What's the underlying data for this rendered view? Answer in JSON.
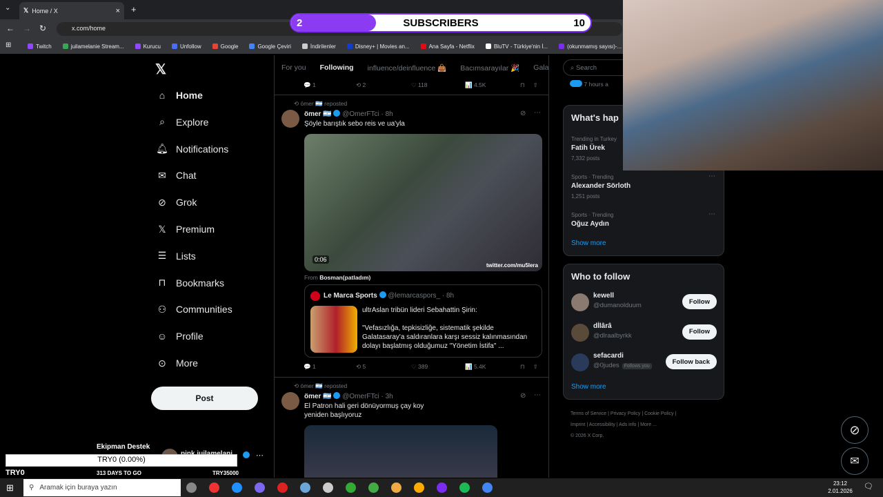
{
  "browser": {
    "tab_title": "Home / X",
    "url": "x.com/home",
    "bookmarks": [
      "Twitch",
      "juilamelanie Stream...",
      "Kurucu",
      "Unfollow",
      "Google",
      "Google Çeviri",
      "İndirilenler",
      "Disney+ | Movies an...",
      "Ana Sayfa - Netflix",
      "BluTV - Türkiye'nin İ...",
      "(okunmamış sayısı)-..."
    ]
  },
  "overlay": {
    "subs_current": "2",
    "subs_label": "SUBSCRIBERS",
    "subs_goal": "10",
    "subs_fraction": 0.2
  },
  "nav": {
    "items": [
      {
        "label": "Home",
        "icon": "home-icon"
      },
      {
        "label": "Explore",
        "icon": "search-icon"
      },
      {
        "label": "Notifications",
        "icon": "bell-icon"
      },
      {
        "label": "Chat",
        "icon": "mail-icon"
      },
      {
        "label": "Grok",
        "icon": "grok-icon"
      },
      {
        "label": "Premium",
        "icon": "x-logo-icon"
      },
      {
        "label": "Lists",
        "icon": "list-icon"
      },
      {
        "label": "Bookmarks",
        "icon": "bookmark-icon"
      },
      {
        "label": "Communities",
        "icon": "people-icon"
      },
      {
        "label": "Profile",
        "icon": "person-icon"
      },
      {
        "label": "More",
        "icon": "more-circle-icon"
      }
    ],
    "post_label": "Post"
  },
  "feed": {
    "tabs": [
      "For you",
      "Following",
      "influence/deinfluence 👜",
      "Bacımsarayılar 🎉",
      "Gala"
    ],
    "top_actions": {
      "replies": "1",
      "reposts": "2",
      "likes": "118",
      "views": "4.5K"
    },
    "post1": {
      "reposted_by": "ömer 🇦🇷 reposted",
      "name": "ömer 🇦🇷",
      "handle": "@OmerFTci",
      "time": "· 8h",
      "text": "Şöyle barıştık sebo reis ve ua'yla",
      "video_time": "0:06",
      "watermark": "twitter.com/mu5lera",
      "from_prefix": "From",
      "from_name": "Bosman(patladım)",
      "quote": {
        "name": "Le Marca Sports",
        "handle": "@lemarcaspors_",
        "time": "· 8h",
        "line1": "ultrAslan tribün lideri Sebahattin Şirin:",
        "line2": "\"Vefasızlığa, tepkisizliğe, sistematik şekilde",
        "line3": "Galatasaray'a saldıranlara karşı sessiz kalınmasından",
        "line4": "dolayı başlatmış olduğumuz \"Yönetim İstifa\" ..."
      },
      "actions": {
        "replies": "1",
        "reposts": "5",
        "likes": "389",
        "views": "5.4K"
      }
    },
    "post2": {
      "reposted_by": "ömer 🇦🇷 reposted",
      "name": "ömer 🇦🇷",
      "handle": "@OmerFTci",
      "time": "· 3h",
      "line1": "El Patron hali geri dönüyormuş çay koy",
      "line2": "yeniden başlıyoruz"
    }
  },
  "right": {
    "search_placeholder": "Search",
    "time_ago": "7 hours a",
    "trending_title": "What's hap",
    "trends": [
      {
        "meta": "Trending in Turkey",
        "name": "Fatih Ürek",
        "count": "7,332 posts"
      },
      {
        "meta": "Sports · Trending",
        "name": "Alexander Sörloth",
        "count": "1,251 posts"
      },
      {
        "meta": "Sports · Trending",
        "name": "Oğuz Aydın",
        "count": ""
      }
    ],
    "show_more": "Show more",
    "who_title": "Who to follow",
    "follow": [
      {
        "name": "kewell",
        "handle": "@dumanolduum",
        "btn": "Follow",
        "tag": ""
      },
      {
        "name": "dİlârâ",
        "handle": "@dlraalbyrkk",
        "btn": "Follow",
        "tag": ""
      },
      {
        "name": "sefacardi",
        "handle": "@0judes",
        "btn": "Follow back",
        "tag": "Follows you"
      }
    ],
    "footer": {
      "l1": "Terms of Service  |  Privacy Policy  |  Cookie Policy  |",
      "l2": "Imprint  |  Accessibility  |  Ads info  |  More ...",
      "l3": "© 2026 X Corp."
    }
  },
  "donation": {
    "title": "Ekipman Destek",
    "bar": "TRY0 (0.00%)",
    "left": "TRY0",
    "mid": "313 DAYS TO GO",
    "right": "TRY35000",
    "fraction": 0.0,
    "account": "pink juilamelani"
  },
  "taskbar": {
    "search": "Aramak için buraya yazın",
    "time": "23:12",
    "date": "2.01.2026"
  },
  "colors": {
    "accent": "#1d9bf0",
    "subs_bar": "#8b3cf2"
  }
}
